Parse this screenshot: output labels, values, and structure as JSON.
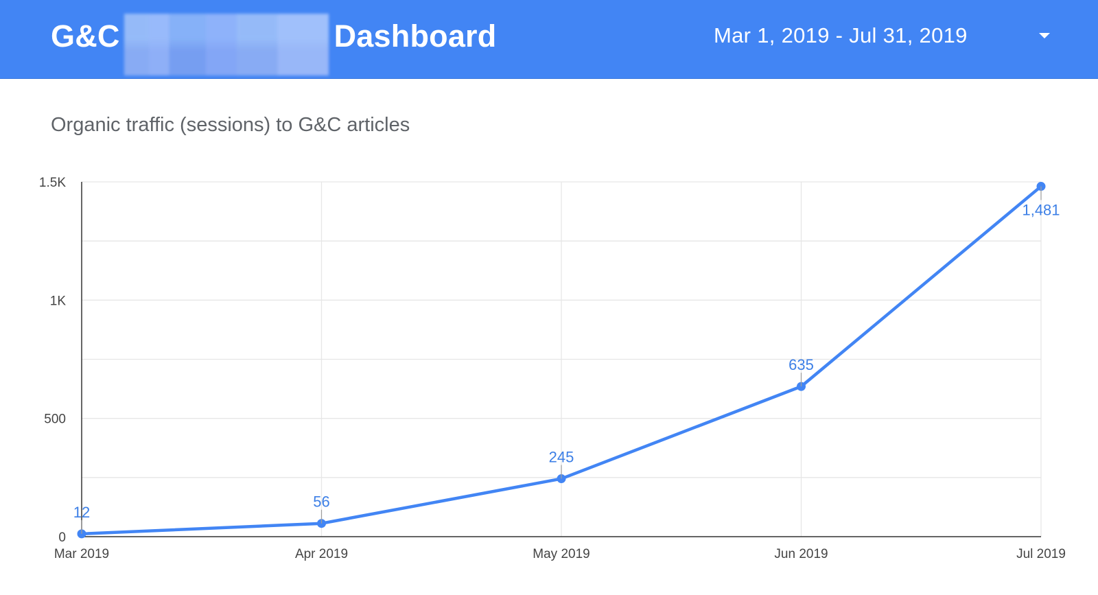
{
  "header": {
    "brand_prefix": "G&C",
    "brand_suffix": "Dashboard",
    "date_range": "Mar 1, 2019 - Jul 31, 2019",
    "dropdown_icon": "caret-down-icon",
    "background_color": "#4285f4"
  },
  "chart_data": {
    "type": "line",
    "title": "Organic traffic (sessions) to G&C articles",
    "categories": [
      "Mar 2019",
      "Apr 2019",
      "May 2019",
      "Jun 2019",
      "Jul 2019"
    ],
    "series": [
      {
        "values": [
          12,
          56,
          245,
          635,
          1481
        ],
        "data_labels": [
          "12",
          "56",
          "245",
          "635",
          "1,481"
        ],
        "color": "#4285f4"
      }
    ],
    "ylim": [
      0,
      1500
    ],
    "y_ticks": [
      {
        "value": 0,
        "label": "0"
      },
      {
        "value": 500,
        "label": "500"
      },
      {
        "value": 1000,
        "label": "1K"
      },
      {
        "value": 1500,
        "label": "1.5K"
      }
    ],
    "grid": true,
    "xlabel": "",
    "ylabel": ""
  }
}
